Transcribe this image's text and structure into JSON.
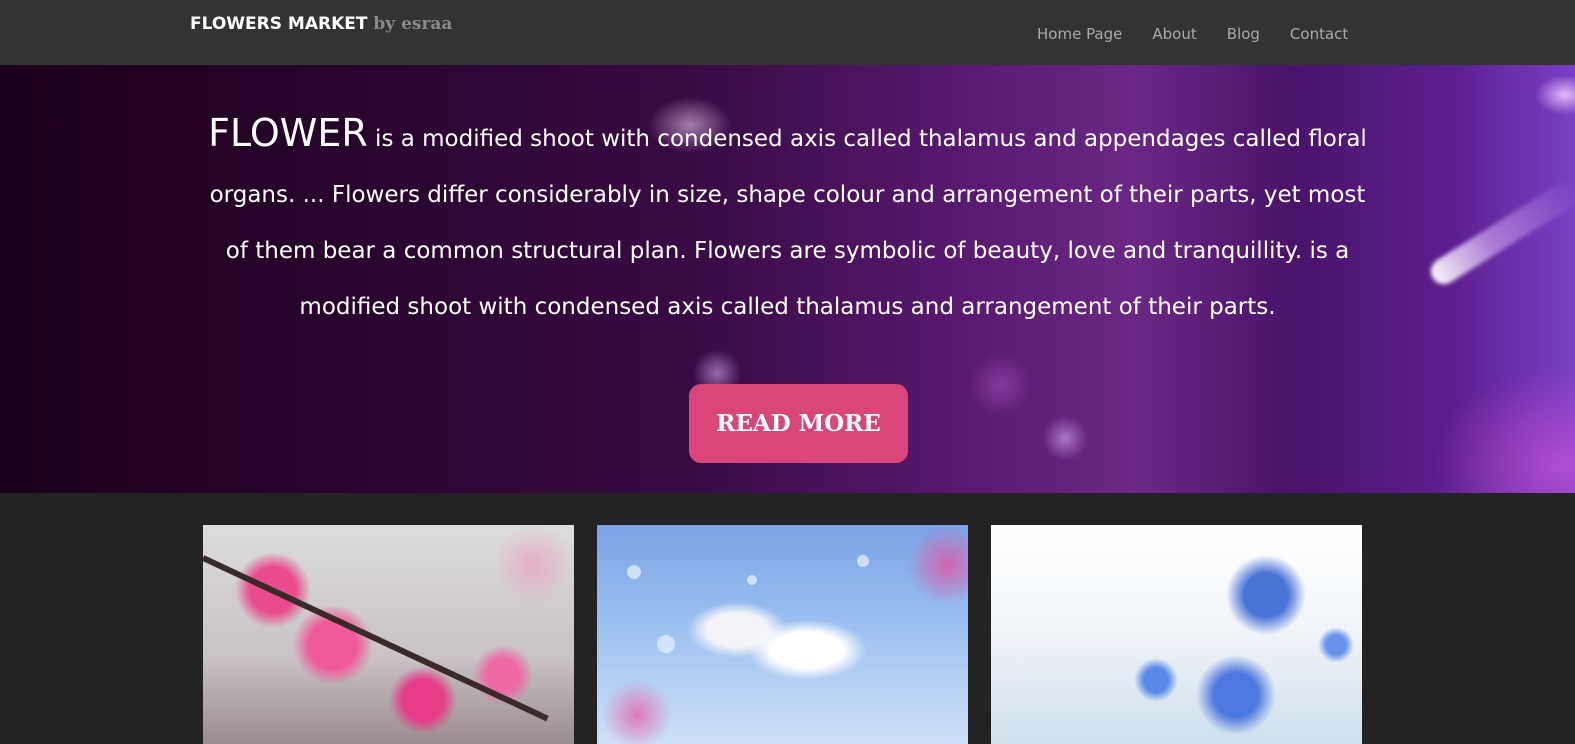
{
  "header": {
    "brand_name": "FLOWERS MARKET",
    "brand_suffix": " by esraa",
    "nav": [
      "Home Page",
      "About",
      "Blog",
      "Contact"
    ]
  },
  "hero": {
    "lead_word": "FLOWER",
    "text": " is a modified shoot with condensed axis called thalamus and appendages called floral organs. ... Flowers differ considerably in size, shape colour and arrangement of their parts, yet most of them bear a common structural plan. Flowers are symbolic of beauty, love and tranquillity. is a modified shoot with condensed axis called thalamus and arrangement of their parts.",
    "button_label": "READ MORE"
  },
  "colors": {
    "header_bg": "#333333",
    "page_bg": "#232323",
    "button_bg": "#d9477a",
    "nav_text": "#a9a9a9"
  },
  "gallery": [
    "pink-blossom-image",
    "white-daisies-image",
    "blue-flowers-image"
  ]
}
